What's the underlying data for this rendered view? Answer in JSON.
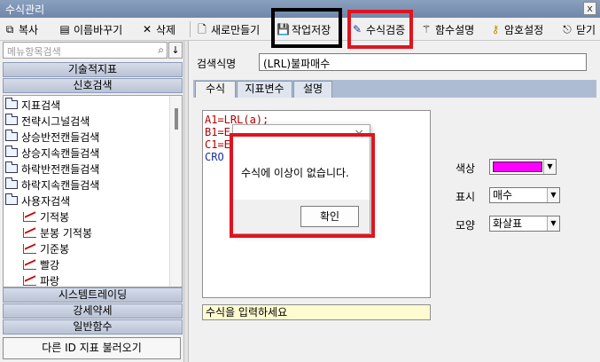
{
  "window": {
    "title": "수식관리",
    "close_label": "x"
  },
  "toolbar": {
    "copy": "복사",
    "rename": "이름바꾸기",
    "delete": "삭제",
    "new": "새로만들기",
    "save": "작업저장",
    "verify": "수식검증",
    "func_help": "함수설명",
    "password": "암호설정",
    "close": "닫기"
  },
  "sidebar": {
    "search_placeholder": "메뉴항목검색",
    "categories": {
      "technical": "기술적지표",
      "signal": "신호검색",
      "system": "시스템트레이딩",
      "strength": "강세약세",
      "general": "일반함수"
    },
    "tree": [
      {
        "label": "지표검색",
        "type": "folder"
      },
      {
        "label": "전략시그널검색",
        "type": "folder"
      },
      {
        "label": "상승반전캔들검색",
        "type": "folder"
      },
      {
        "label": "상승지속캔들검색",
        "type": "folder"
      },
      {
        "label": "하락반전캔들검색",
        "type": "folder"
      },
      {
        "label": "하락지속캔들검색",
        "type": "folder"
      },
      {
        "label": "사용자검색",
        "type": "folder"
      },
      {
        "label": "기적봉",
        "type": "chart"
      },
      {
        "label": "분봉 기적봉",
        "type": "chart"
      },
      {
        "label": "기준봉",
        "type": "chart"
      },
      {
        "label": "빨강",
        "type": "chart"
      },
      {
        "label": "파랑",
        "type": "chart"
      }
    ],
    "load_button": "다른 ID 지표 불러오기"
  },
  "main": {
    "name_label": "검색식명",
    "name_value": "(LRL)불파매수",
    "tabs": [
      "수식",
      "지표변수",
      "설명"
    ],
    "formula_lines": [
      "A1=LRL(a);",
      "B1=E",
      "C1=E",
      "",
      "CRO"
    ],
    "formula_hint": "수식을 입력하세요",
    "color_label": "색상",
    "color_value": "#ff00ff",
    "display_label": "표시",
    "display_value": "매수",
    "shape_label": "모양",
    "shape_value": "화살표"
  },
  "dialog": {
    "close_label": "×",
    "message": "수식에 이상이 없습니다.",
    "ok_label": "확인"
  }
}
